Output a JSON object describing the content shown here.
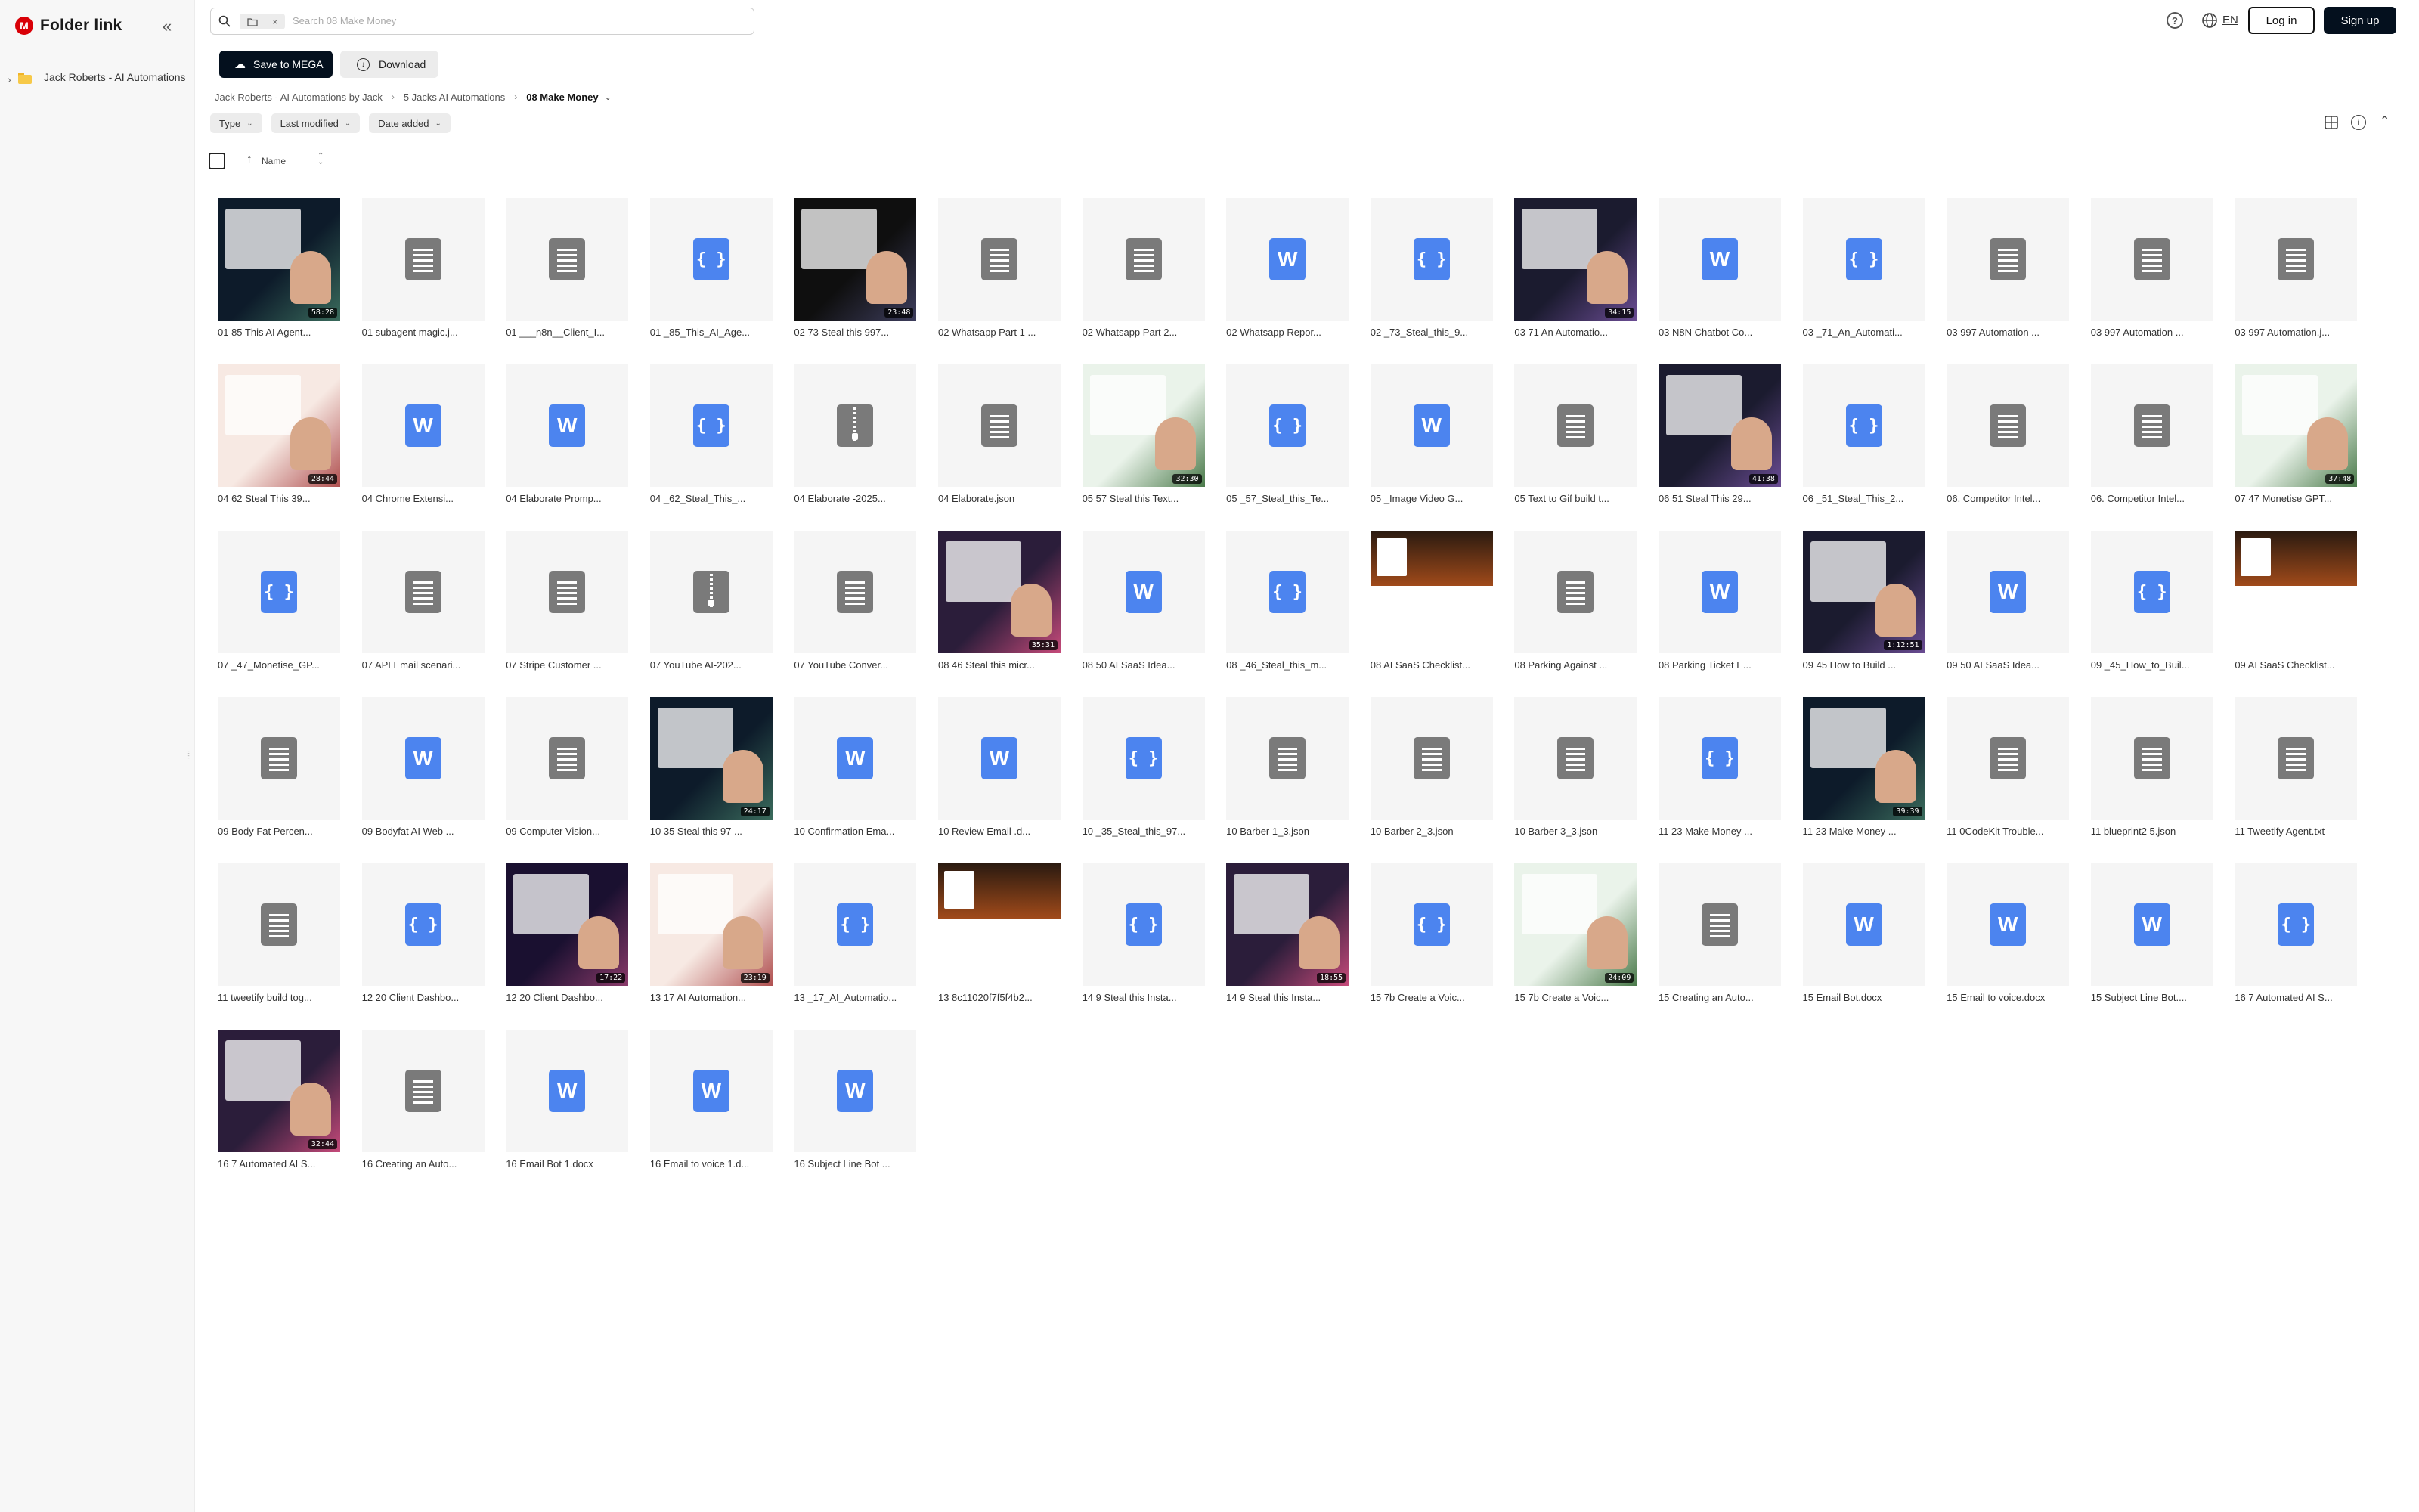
{
  "app": {
    "logo_letter": "M",
    "title": "Folder link"
  },
  "sidebar": {
    "collapse_glyph": "«",
    "tree_chevron": "›",
    "folder_label": "Jack Roberts - AI Automations",
    "resize_glyph": "⦙"
  },
  "search": {
    "placeholder": "Search 08 Make Money",
    "chip_close": "×"
  },
  "header": {
    "help_glyph": "?",
    "language": "EN",
    "login_label": "Log in",
    "signup_label": "Sign up"
  },
  "actions": {
    "save_label": "Save to MEGA",
    "download_label": "Download"
  },
  "breadcrumb": {
    "items": [
      "Jack Roberts - AI Automations by Jack",
      "5 Jacks AI Automations"
    ],
    "current": "08 Make Money"
  },
  "filters": [
    {
      "label": "Type"
    },
    {
      "label": "Last modified"
    },
    {
      "label": "Date added"
    }
  ],
  "column": {
    "name_label": "Name",
    "sort_glyph": "↑"
  },
  "colors": {
    "brand": "#d90007",
    "primary": "#04101e",
    "file_blue": "#4c84ef",
    "file_grey": "#7a7a7a"
  },
  "files": [
    {
      "name": "01 85 This AI Agent...",
      "type": "video",
      "duration": "58:28"
    },
    {
      "name": "01 subagent magic.j...",
      "type": "text"
    },
    {
      "name": "01 ___n8n__Client_I...",
      "type": "text"
    },
    {
      "name": "01 _85_This_AI_Age...",
      "type": "json"
    },
    {
      "name": "02 73 Steal this 997...",
      "type": "video",
      "duration": "23:48"
    },
    {
      "name": "02 Whatsapp Part 1 ...",
      "type": "text"
    },
    {
      "name": "02 Whatsapp Part 2...",
      "type": "text"
    },
    {
      "name": "02 Whatsapp Repor...",
      "type": "word"
    },
    {
      "name": "02 _73_Steal_this_9...",
      "type": "json"
    },
    {
      "name": "03 71 An Automatio...",
      "type": "video",
      "duration": "34:15"
    },
    {
      "name": "03 N8N Chatbot Co...",
      "type": "word"
    },
    {
      "name": "03 _71_An_Automati...",
      "type": "json"
    },
    {
      "name": "03 997 Automation ...",
      "type": "text"
    },
    {
      "name": "03 997 Automation ...",
      "type": "text"
    },
    {
      "name": "03 997 Automation.j...",
      "type": "text"
    },
    {
      "name": "04 62 Steal This 39...",
      "type": "video",
      "duration": "28:44"
    },
    {
      "name": "04 Chrome Extensi...",
      "type": "word"
    },
    {
      "name": "04 Elaborate Promp...",
      "type": "word"
    },
    {
      "name": "04 _62_Steal_This_...",
      "type": "json"
    },
    {
      "name": "04 Elaborate -2025...",
      "type": "zip"
    },
    {
      "name": "04 Elaborate.json",
      "type": "text"
    },
    {
      "name": "05 57 Steal this Text...",
      "type": "video",
      "duration": "32:30"
    },
    {
      "name": "05 _57_Steal_this_Te...",
      "type": "json"
    },
    {
      "name": "05 _Image Video G...",
      "type": "word"
    },
    {
      "name": "05 Text to Gif build t...",
      "type": "text"
    },
    {
      "name": "06 51 Steal This 29...",
      "type": "video",
      "duration": "41:38"
    },
    {
      "name": "06 _51_Steal_This_2...",
      "type": "json"
    },
    {
      "name": "06. Competitor Intel...",
      "type": "text"
    },
    {
      "name": "06. Competitor Intel...",
      "type": "text"
    },
    {
      "name": "07 47 Monetise GPT...",
      "type": "video",
      "duration": "37:48"
    },
    {
      "name": "07 _47_Monetise_GP...",
      "type": "json"
    },
    {
      "name": "07 API Email scenari...",
      "type": "text"
    },
    {
      "name": "07 Stripe Customer ...",
      "type": "text"
    },
    {
      "name": "07 YouTube AI-202...",
      "type": "zip"
    },
    {
      "name": "07 YouTube Conver...",
      "type": "text"
    },
    {
      "name": "08 46 Steal this micr...",
      "type": "video",
      "duration": "35:31"
    },
    {
      "name": "08 50 AI SaaS Idea...",
      "type": "word"
    },
    {
      "name": "08 _46_Steal_this_m...",
      "type": "json"
    },
    {
      "name": "08 AI SaaS Checklist...",
      "type": "image"
    },
    {
      "name": "08 Parking Against ...",
      "type": "text"
    },
    {
      "name": "08 Parking Ticket E...",
      "type": "word"
    },
    {
      "name": "09 45 How to Build ...",
      "type": "video",
      "duration": "1:12:51"
    },
    {
      "name": "09 50 AI SaaS Idea...",
      "type": "word"
    },
    {
      "name": "09 _45_How_to_Buil...",
      "type": "json"
    },
    {
      "name": "09 AI SaaS Checklist...",
      "type": "image"
    },
    {
      "name": "09 Body Fat Percen...",
      "type": "text"
    },
    {
      "name": "09 Bodyfat AI Web ...",
      "type": "word"
    },
    {
      "name": "09 Computer Vision...",
      "type": "text"
    },
    {
      "name": "10 35 Steal this 97 ...",
      "type": "video",
      "duration": "24:17"
    },
    {
      "name": "10 Confirmation Ema...",
      "type": "word"
    },
    {
      "name": "10  Review Email .d...",
      "type": "word"
    },
    {
      "name": "10 _35_Steal_this_97...",
      "type": "json"
    },
    {
      "name": "10 Barber 1_3.json",
      "type": "text"
    },
    {
      "name": "10 Barber 2_3.json",
      "type": "text"
    },
    {
      "name": "10 Barber 3_3.json",
      "type": "text"
    },
    {
      "name": "11 23 Make Money ...",
      "type": "json"
    },
    {
      "name": "11 23 Make Money ...",
      "type": "video",
      "duration": "39:39"
    },
    {
      "name": "11 0CodeKit Trouble...",
      "type": "text"
    },
    {
      "name": "11 blueprint2 5.json",
      "type": "text"
    },
    {
      "name": "11 Tweetify Agent.txt",
      "type": "text"
    },
    {
      "name": "11 tweetify build tog...",
      "type": "text"
    },
    {
      "name": "12 20 Client Dashbo...",
      "type": "json"
    },
    {
      "name": "12 20 Client Dashbo...",
      "type": "video",
      "duration": "17:22"
    },
    {
      "name": "13 17 AI Automation...",
      "type": "video",
      "duration": "23:19"
    },
    {
      "name": "13 _17_AI_Automatio...",
      "type": "json"
    },
    {
      "name": "13 8c11020f7f5f4b2...",
      "type": "image"
    },
    {
      "name": "14 9 Steal this Insta...",
      "type": "json"
    },
    {
      "name": "14 9 Steal this Insta...",
      "type": "video",
      "duration": "18:55"
    },
    {
      "name": "15 7b Create a Voic...",
      "type": "json"
    },
    {
      "name": "15 7b Create a Voic...",
      "type": "video",
      "duration": "24:09"
    },
    {
      "name": "15 Creating an Auto...",
      "type": "text"
    },
    {
      "name": "15 Email Bot.docx",
      "type": "word"
    },
    {
      "name": "15 Email to voice.docx",
      "type": "word"
    },
    {
      "name": "15 Subject Line Bot....",
      "type": "word"
    },
    {
      "name": "16 7 Automated AI S...",
      "type": "json"
    },
    {
      "name": "16 7 Automated AI S...",
      "type": "video",
      "duration": "32:44"
    },
    {
      "name": "16 Creating an Auto...",
      "type": "text"
    },
    {
      "name": "16 Email Bot 1.docx",
      "type": "word"
    },
    {
      "name": "16 Email to voice 1.d...",
      "type": "word"
    },
    {
      "name": "16 Subject Line Bot ...",
      "type": "word"
    }
  ]
}
